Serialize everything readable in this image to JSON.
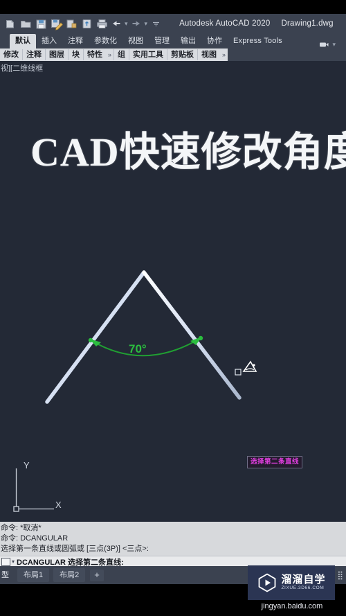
{
  "window": {
    "app_title": "Autodesk AutoCAD 2020",
    "document_name": "Drawing1.dwg"
  },
  "quick_access": {
    "icons": [
      {
        "name": "new-file-icon",
        "label": "新建"
      },
      {
        "name": "open-folder-icon",
        "label": "打开"
      },
      {
        "name": "save-icon",
        "label": "保存"
      },
      {
        "name": "save-as-icon",
        "label": "另存为"
      },
      {
        "name": "plot-preview-icon",
        "label": "打印预览"
      },
      {
        "name": "export-icon",
        "label": "输出"
      },
      {
        "name": "print-icon",
        "label": "打印"
      }
    ],
    "undo_label": "撤销",
    "redo_label": "重做",
    "customize_label": "自定义快速访问工具栏"
  },
  "ribbon": {
    "tabs": [
      {
        "label": "默认",
        "active": true
      },
      {
        "label": "插入",
        "active": false
      },
      {
        "label": "注释",
        "active": false
      },
      {
        "label": "参数化",
        "active": false
      },
      {
        "label": "视图",
        "active": false
      },
      {
        "label": "管理",
        "active": false
      },
      {
        "label": "输出",
        "active": false
      },
      {
        "label": "协作",
        "active": false
      },
      {
        "label": "Express Tools",
        "active": false
      }
    ],
    "panels": [
      {
        "label": "修改",
        "chevron": false
      },
      {
        "label": "注释",
        "chevron": false
      },
      {
        "label": "图层",
        "chevron": false
      },
      {
        "label": "块",
        "chevron": false
      },
      {
        "label": "特性",
        "chevron": true
      },
      {
        "label": "组",
        "chevron": false
      },
      {
        "label": "实用工具",
        "chevron": false
      },
      {
        "label": "剪贴板",
        "chevron": false
      },
      {
        "label": "视图",
        "chevron": true
      }
    ],
    "chevron_glyph": "»"
  },
  "viewport": {
    "label": "视][二维线框"
  },
  "canvas": {
    "title_text": "CAD快速修改角度",
    "dimension_value": "70°",
    "dimension_color": "#2bbd3f",
    "line_color": "#e8edf7",
    "background_color": "#232936",
    "tooltip_text": "选择第二条直线",
    "tooltip_color": "#e23fe0",
    "ucs": {
      "x_label": "X",
      "y_label": "Y"
    }
  },
  "command_line": {
    "history": [
      "命令: *取消*",
      "命令: DCANGULAR",
      "选择第一条直线或圆弧或 [三点(3P)] <三点>:"
    ],
    "prompt": "DCANGULAR 选择第二条直线:"
  },
  "status_bar": {
    "tabs": [
      {
        "label": "型",
        "name": "model-tab"
      },
      {
        "label": "布局1",
        "name": "layout1-tab"
      },
      {
        "label": "布局2",
        "name": "layout2-tab"
      }
    ],
    "add_label": "+",
    "icons": [
      {
        "name": "grid-icon",
        "glyph": "▦"
      },
      {
        "name": "more-options-icon",
        "glyph": "⣿"
      }
    ]
  },
  "watermark": {
    "brand_cn": "溜溜自学",
    "brand_en": "ZIXUE.3D66.COM",
    "source": "jingyan.baidu.com"
  }
}
